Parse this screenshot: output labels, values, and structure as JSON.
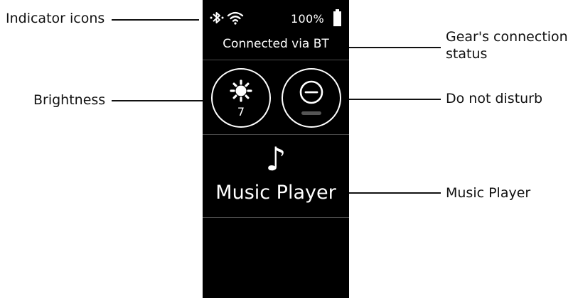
{
  "callouts": {
    "indicator_icons": "Indicator icons",
    "brightness": "Brightness",
    "connection_status_line1": "Gear's connection",
    "connection_status_line2": "status",
    "do_not_disturb": "Do not disturb",
    "music_player": "Music Player"
  },
  "device": {
    "status_bar": {
      "icons": [
        "bluetooth-icon",
        "wifi-icon",
        "battery-icon"
      ],
      "battery_text": "100%"
    },
    "connection_status": "Connected via BT",
    "quick_panel": {
      "brightness": {
        "icon": "sun-icon",
        "level": "7"
      },
      "do_not_disturb": {
        "icon": "minus-circle-icon"
      }
    },
    "music_tile": {
      "icon": "music-note-icon",
      "note_glyph": "♪",
      "label": "Music Player"
    }
  },
  "colors": {
    "screen": "#000000",
    "foreground": "#ffffff",
    "divider": "#4a4a4a",
    "inactive": "#555555"
  }
}
